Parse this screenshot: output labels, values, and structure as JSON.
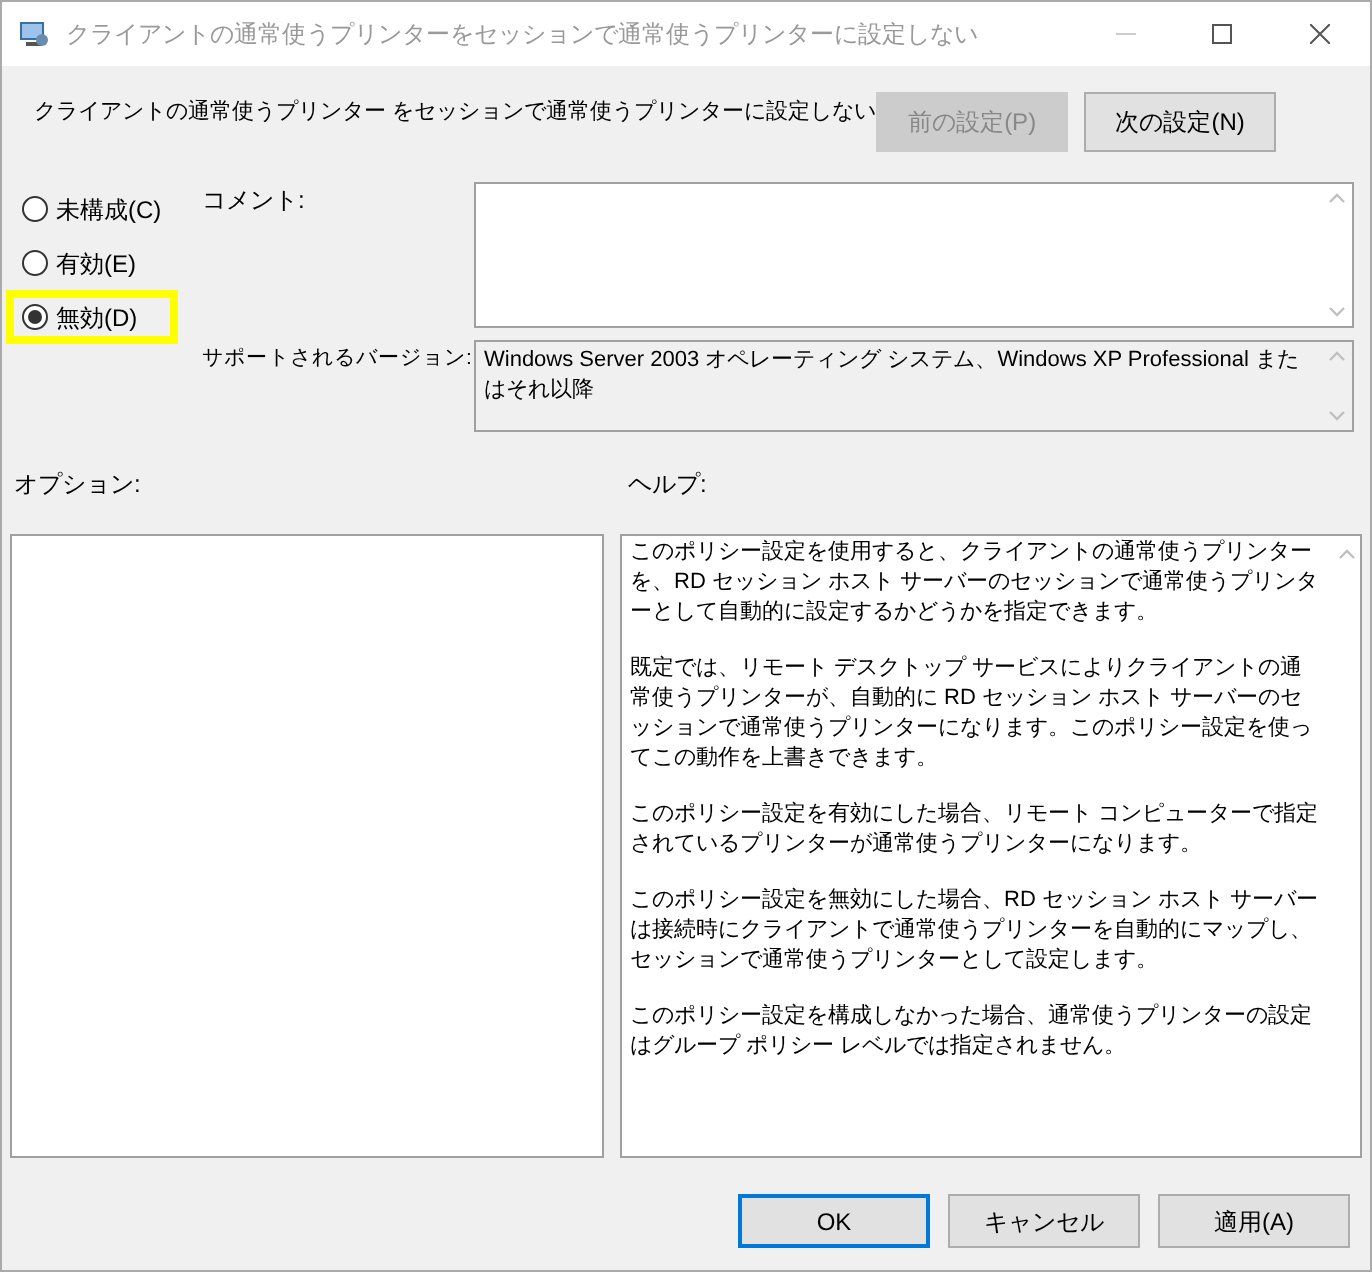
{
  "window": {
    "title": "クライアントの通常使うプリンターをセッションで通常使うプリンターに設定しない"
  },
  "header": {
    "policy_name": "クライアントの通常使うプリンター をセッションで通常使うプリンターに設定しない",
    "buttons": [
      {
        "label": "前の設定(P)",
        "disabled": true
      },
      {
        "label": "次の設定(N)",
        "disabled": false
      }
    ]
  },
  "state_options": [
    {
      "label": "未構成(C)",
      "selected": false,
      "highlighted": false
    },
    {
      "label": "有効(E)",
      "selected": false,
      "highlighted": false
    },
    {
      "label": "無効(D)",
      "selected": true,
      "highlighted": true
    }
  ],
  "comment": {
    "label": "コメント:"
  },
  "supported": {
    "label": "サポートされるバージョン:",
    "value": "Windows Server 2003 オペレーティング システム、Windows XP Professional またはそれ以降"
  },
  "options": {
    "label": "オプション:"
  },
  "help": {
    "label": "ヘルプ:",
    "paragraphs": [
      "このポリシー設定を使用すると、クライアントの通常使うプリンターを、RD セッション ホスト サーバーのセッションで通常使うプリンターとして自動的に設定するかどうかを指定できます。",
      "既定では、リモート デスクトップ サービスによりクライアントの通常使うプリンターが、自動的に RD セッション ホスト サーバーのセッションで通常使うプリンターになります。このポリシー設定を使ってこの動作を上書きできます。",
      "このポリシー設定を有効にした場合、リモート コンピューターで指定されているプリンターが通常使うプリンターになります。",
      "このポリシー設定を無効にした場合、RD セッション ホスト サーバーは接続時にクライアントで通常使うプリンターを自動的にマップし、セッションで通常使うプリンターとして設定します。",
      "このポリシー設定を構成しなかった場合、通常使うプリンターの設定はグループ ポリシー レベルでは指定されません。"
    ]
  },
  "footer_buttons": [
    {
      "label": "OK",
      "default": true
    },
    {
      "label": "キャンセル",
      "default": false
    },
    {
      "label": "適用(A)",
      "default": false
    }
  ]
}
